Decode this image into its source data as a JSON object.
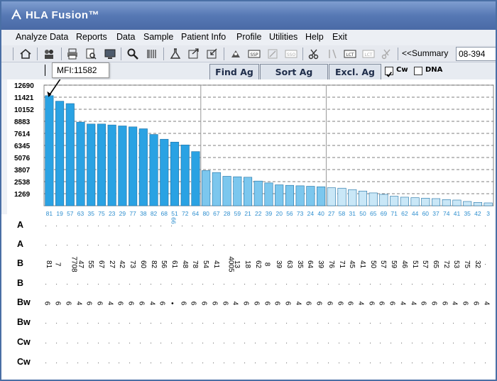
{
  "window": {
    "title": "HLA Fusion™"
  },
  "menu": [
    "Analyze Data",
    "Reports",
    "Data",
    "Sample",
    "Patient Info",
    "Profile",
    "Utilities",
    "Help",
    "Exit"
  ],
  "toolbar": {
    "icons": [
      "home-icon",
      "patient-icon",
      "print-icon",
      "print-preview-icon",
      "monitor-icon",
      "search-icon",
      "barcode-icon",
      "flask-icon",
      "export-icon",
      "import-icon",
      "tray-icon",
      "tools-icon",
      "ssp-icon",
      "sso-icon",
      "scissors-icon",
      "adjust-icon",
      "lct-icon",
      "lct-disabled-icon",
      "cut-disabled-icon"
    ],
    "summary_label": "<<Summary",
    "case_value": "08-394"
  },
  "actions": {
    "tooltip": "MFI:11582",
    "find_label": "Find Ag",
    "sort_label": "Sort Ag",
    "excl_label": "Excl. Ag",
    "cw_label": "Cw",
    "cw_checked": true,
    "dna_label": "DNA",
    "dna_checked": false
  },
  "chart_data": {
    "type": "bar",
    "ylabel": "",
    "yticks": [
      12690,
      11421,
      10152,
      8883,
      7614,
      6345,
      5076,
      3807,
      2538,
      1269
    ],
    "ylim": [
      0,
      12690
    ],
    "grid": true,
    "annotation": "MFI:11582",
    "categories": [
      "81",
      "19",
      "57",
      "63",
      "35",
      "75",
      "23",
      "29",
      "77",
      "38",
      "82",
      "68",
      "51",
      "72",
      "64",
      "80",
      "67",
      "28",
      "59",
      "21",
      "22",
      "39",
      "20",
      "56",
      "73",
      "24",
      "40",
      "27",
      "58",
      "31",
      "50",
      "65",
      "69",
      "71",
      "62",
      "44",
      "60",
      "37",
      "74",
      "41",
      "35",
      "42",
      "3"
    ],
    "values": [
      11582,
      11000,
      10750,
      8800,
      8600,
      8600,
      8500,
      8400,
      8300,
      8100,
      7500,
      7000,
      6700,
      6400,
      5700,
      3700,
      3500,
      3100,
      3050,
      3000,
      2600,
      2400,
      2200,
      2150,
      2100,
      2050,
      2000,
      1900,
      1850,
      1700,
      1550,
      1350,
      1200,
      1000,
      900,
      850,
      800,
      750,
      650,
      600,
      450,
      350,
      300
    ],
    "series_colors": {
      "strong": "#2aa2e3",
      "medium": "#7cc7ee",
      "weak": "#c9e7f7"
    },
    "band_boundaries": [
      15,
      27
    ]
  },
  "x_subtick_label": "66",
  "rows": [
    {
      "label": "A",
      "values": []
    },
    {
      "label": "A",
      "values": []
    },
    {
      "label": "B",
      "values": [
        "81",
        "7",
        "7708",
        "47",
        "55",
        "67",
        "27",
        "42",
        "73",
        "60",
        "82",
        "56",
        "61",
        "48",
        "78",
        "54",
        "41",
        "4005",
        "13",
        "18",
        "62",
        "8",
        "39",
        "63",
        "35",
        "64",
        "39",
        "76",
        "71",
        "45",
        "41",
        "50",
        "57",
        "59",
        "46",
        "51",
        "57",
        "65",
        "72",
        "53",
        "75",
        "32"
      ]
    },
    {
      "label": "B",
      "values": []
    },
    {
      "label": "Bw",
      "values": [
        "6",
        "6",
        "6",
        "4",
        "6",
        "6",
        "4",
        "6",
        "6",
        "6",
        "4",
        "6",
        "•",
        "6",
        "6",
        "6",
        "6",
        "6",
        "4",
        "6",
        "6",
        "6",
        "6",
        "6",
        "4",
        "6",
        "6",
        "6",
        "6",
        "6",
        "4",
        "6",
        "6",
        "6",
        "4",
        "4",
        "6",
        "6",
        "6",
        "4",
        "6",
        "6",
        "4"
      ]
    },
    {
      "label": "Bw",
      "values": []
    },
    {
      "label": "Cw",
      "values": []
    },
    {
      "label": "Cw",
      "values": []
    }
  ],
  "colors": {
    "title_bar": "#5678b4",
    "accent": "#2aa2e3",
    "grid": "#555555"
  }
}
